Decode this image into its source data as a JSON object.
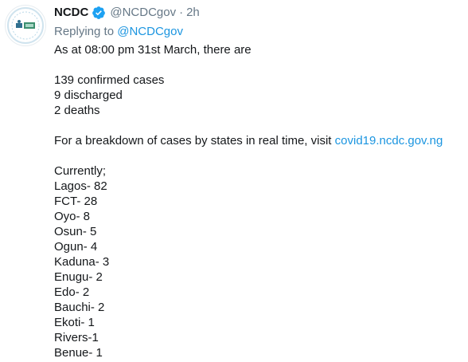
{
  "tweet": {
    "author_name": "NCDC",
    "author_handle": "@NCDCgov",
    "separator": "·",
    "time": "2h",
    "replying_prefix": "Replying to",
    "replying_handle": "@NCDCgov",
    "intro": "As at 08:00 pm 31st March, there are",
    "stats": [
      "139 confirmed cases",
      "9 discharged",
      "2 deaths"
    ],
    "breakdown_text": "For a breakdown of cases by states in real time, visit",
    "breakdown_link": "covid19.ncdc.gov.ng",
    "currently_label": "Currently;",
    "states": [
      "Lagos- 82",
      "FCT- 28",
      "Oyo- 8",
      "Osun- 5",
      "Ogun- 4",
      "Kaduna- 3",
      "Enugu- 2",
      "Edo- 2",
      "Bauchi- 2",
      "Ekoti- 1",
      "Rivers-1",
      "Benue- 1"
    ]
  },
  "colors": {
    "text": "#14171a",
    "muted": "#657786",
    "link": "#1b95e0",
    "verified_badge": "#1da1f2"
  },
  "icons": {
    "avatar": "ncdc-logo-avatar",
    "verified": "verified-badge-icon"
  }
}
